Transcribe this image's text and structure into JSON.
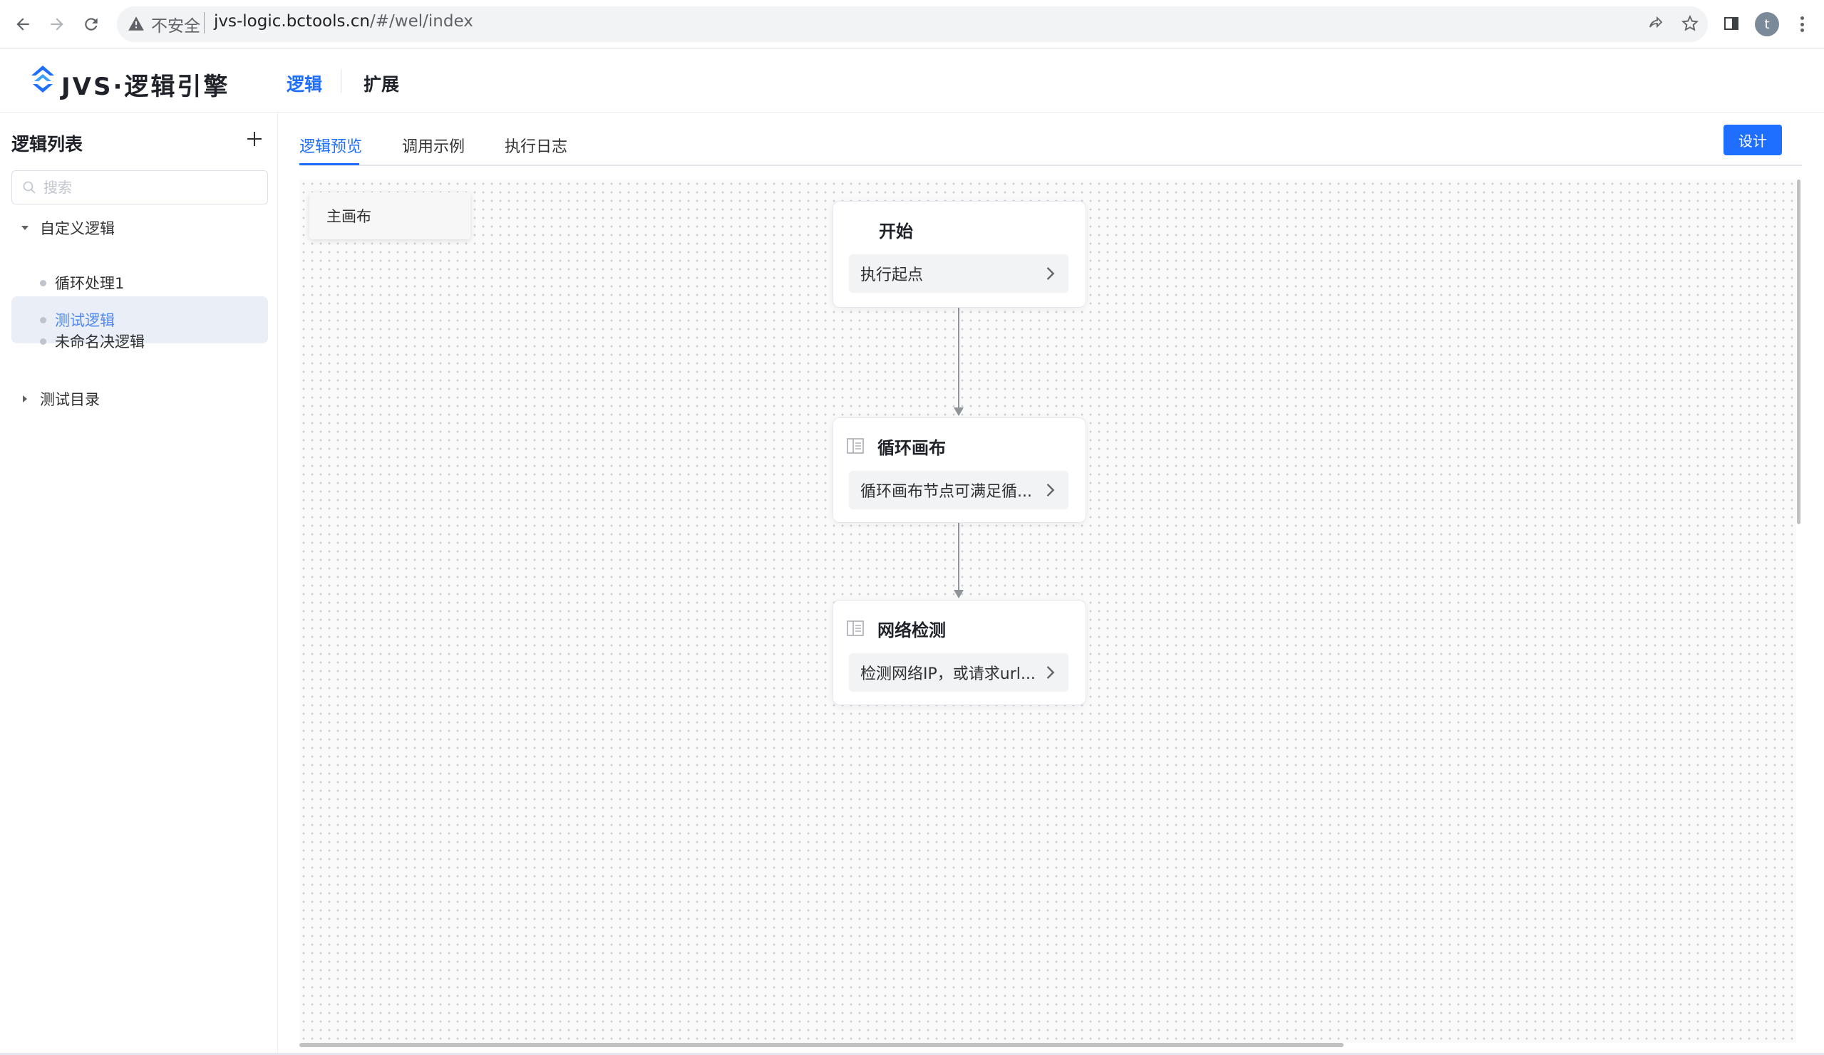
{
  "browser": {
    "insecure_label": "不安全",
    "url_host": "jvs-logic.bctools.cn",
    "url_path": "/#/wel/index",
    "avatar_letter": "t"
  },
  "app": {
    "logo_text": "JVS·逻辑引擎",
    "nav": [
      "逻辑",
      "扩展"
    ]
  },
  "sidebar": {
    "title": "逻辑列表",
    "search_placeholder": "搜索",
    "folders": [
      {
        "label": "自定义逻辑",
        "expanded": true,
        "items": [
          {
            "label": "循环处理1",
            "selected": false
          },
          {
            "label": "测试逻辑",
            "selected": true
          },
          {
            "label": "未命名决逻辑",
            "selected": false
          }
        ]
      },
      {
        "label": "测试目录",
        "expanded": false
      }
    ]
  },
  "main": {
    "tabs": [
      "逻辑预览",
      "调用示例",
      "执行日志"
    ],
    "active_tab": "逻辑预览",
    "design_button": "设计",
    "canvas_tab": "主画布",
    "nodes": [
      {
        "title": "开始",
        "desc": "执行起点",
        "icon": "none"
      },
      {
        "title": "循环画布",
        "desc": "循环画布节点可满足循...",
        "icon": "table-icon"
      },
      {
        "title": "网络检测",
        "desc": "检测网络IP，或请求url...",
        "icon": "table-icon"
      }
    ]
  },
  "colors": {
    "accent": "#1e6fff",
    "selected_bg": "#eaeef7",
    "selected_text": "#4f87f0"
  }
}
